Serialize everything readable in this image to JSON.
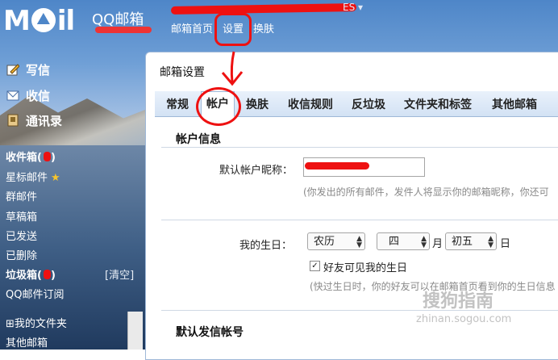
{
  "header": {
    "logo": "MoiI",
    "app_title": "QQ邮箱",
    "account_suffix": "ES",
    "nav": [
      {
        "label": "邮箱首页"
      },
      {
        "label": "设置"
      },
      {
        "label": "换肤"
      }
    ]
  },
  "sidebar": {
    "compose": "写信",
    "inbox": "收信",
    "contacts": "通讯录",
    "folders": [
      {
        "label": "收件箱("
      },
      {
        "label": "星标邮件"
      },
      {
        "label": "群邮件"
      },
      {
        "label": "草稿箱"
      },
      {
        "label": "已发送"
      },
      {
        "label": "已删除"
      },
      {
        "label": "垃圾箱("
      },
      {
        "label": "QQ邮件订阅"
      }
    ],
    "inbox_suffix": ")",
    "spam_suffix": ")",
    "spam_clear": "[清空]",
    "my_folders": "我的文件夹",
    "other_mailboxes": "其他邮箱"
  },
  "settings": {
    "title": "邮箱设置",
    "tabs": [
      {
        "label": "常规"
      },
      {
        "label": "帐户"
      },
      {
        "label": "换肤"
      },
      {
        "label": "收信规则"
      },
      {
        "label": "反垃圾"
      },
      {
        "label": "文件夹和标签"
      },
      {
        "label": "其他邮箱"
      }
    ],
    "account_info_heading": "帐户信息",
    "nickname_label": "默认帐户昵称：",
    "nickname_hint": "(你发出的所有邮件，发件人将显示你的邮箱昵称，你还可",
    "birthday_label": "我的生日：",
    "calendar_value": "农历",
    "month_value": "四",
    "month_unit": "月",
    "day_value": "初五",
    "day_unit": "日",
    "friends_visible_label": "好友可见我的生日",
    "friends_visible_checked": true,
    "birthday_hint": "(快过生日时，你的好友可以在邮箱首页看到你的生日信息",
    "default_sender_heading": "默认发信帐号"
  },
  "watermark": {
    "text": "搜狗指南",
    "domain": "zhinan.sogou.com"
  },
  "colors": {
    "annotation": "#e11111",
    "tab_bar": "#d3e2f4",
    "link": "#ffffff"
  }
}
